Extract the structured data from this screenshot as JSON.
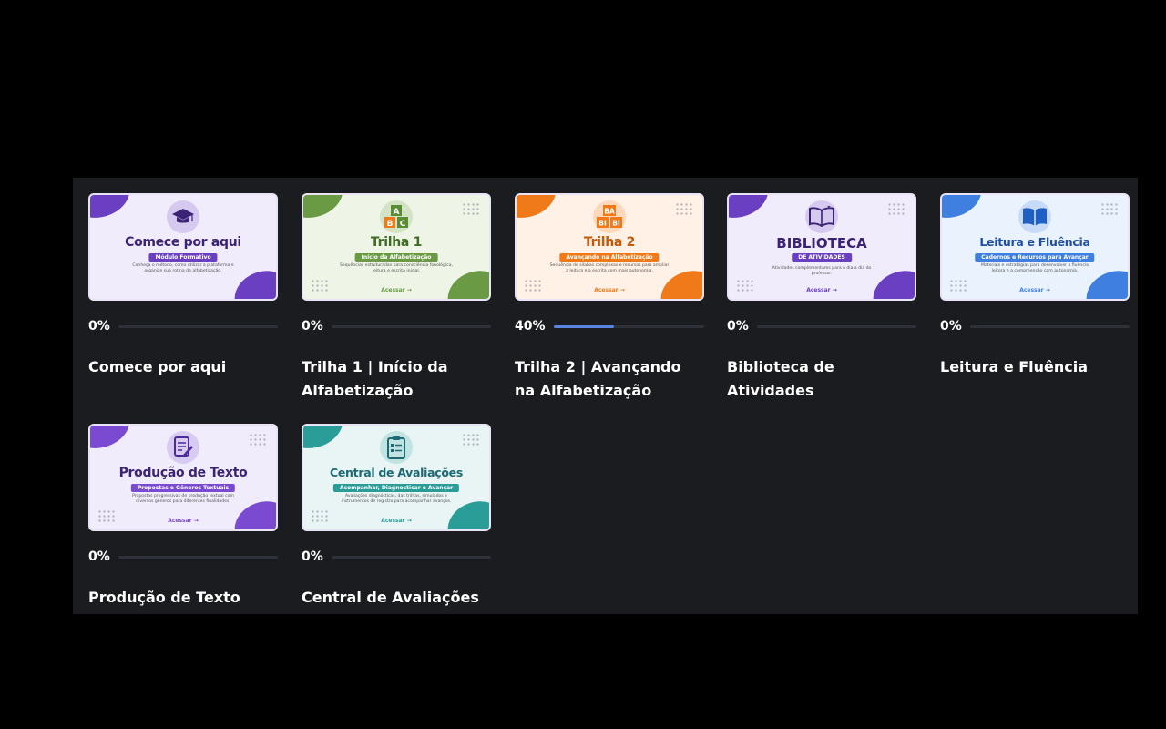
{
  "courses": [
    {
      "thumb": {
        "title": "Comece por aqui",
        "pill": "Módulo Formativo",
        "desc": "Conheça o método, como utilizar a plataforma e organize sua rotina de alfabetização.",
        "access": "",
        "icon": "graduation-cap-icon"
      },
      "colors": {
        "bg": "#f1ecfb",
        "accent": "#6a3fc1",
        "title": "#3a2374"
      },
      "progress_label": "0%",
      "progress": 0,
      "name": "Comece por aqui"
    },
    {
      "thumb": {
        "title": "Trilha 1",
        "pill": "Início da Alfabetização",
        "desc": "Sequências estruturadas para consciência fonológica, leitura e escrita inicial.",
        "access": "Acessar →",
        "icon": "abc-blocks-icon"
      },
      "colors": {
        "bg": "#eef5e6",
        "accent": "#6b9a45",
        "title": "#3f6b24"
      },
      "progress_label": "0%",
      "progress": 0,
      "name": "Trilha 1 | Início da Alfabetização"
    },
    {
      "thumb": {
        "title": "Trilha 2",
        "pill": "Avançando na Alfabetização",
        "desc": "Sequência de sílabas complexas e recursos para ampliar a leitura e a escrita com mais autonomia.",
        "access": "Acessar →",
        "icon": "syllable-blocks-icon"
      },
      "colors": {
        "bg": "#fff1e6",
        "accent": "#f07a1a",
        "title": "#c25a0c"
      },
      "progress_label": "40%",
      "progress": 0.4,
      "name": "Trilha 2 | Avançando na Alfabetização"
    },
    {
      "thumb": {
        "title": "BIBLIOTECA",
        "pill": "DE ATIVIDADES",
        "desc": "Atividades complementares para o dia a dia do professor.",
        "access": "Acessar →",
        "icon": "open-book-icon"
      },
      "colors": {
        "bg": "#f1ecfb",
        "accent": "#6a3fc1",
        "title": "#3a2374"
      },
      "progress_label": "0%",
      "progress": 0,
      "name": "Biblioteca de Atividades"
    },
    {
      "thumb": {
        "title": "Leitura e Fluência",
        "pill": "Cadernos e Recursos para Avançar",
        "desc": "Materiais e estratégias para desenvolver a fluência leitora e a compreensão com autonomia.",
        "access": "Acessar →",
        "icon": "book-icon"
      },
      "colors": {
        "bg": "#eaf2fd",
        "accent": "#3e7fe0",
        "title": "#1f4fa5"
      },
      "progress_label": "0%",
      "progress": 0,
      "name": "Leitura e Fluência"
    },
    {
      "thumb": {
        "title": "Produção de Texto",
        "pill": "Propostas e Gêneros Textuais",
        "desc": "Propostas progressivas de produção textual com diversos gêneros para diferentes finalidades.",
        "access": "Acessar →",
        "icon": "document-pen-icon"
      },
      "colors": {
        "bg": "#f1ecfb",
        "accent": "#7a4bd0",
        "title": "#3a2374"
      },
      "progress_label": "0%",
      "progress": 0,
      "name": "Produção de Texto"
    },
    {
      "thumb": {
        "title": "Central de Avaliações",
        "pill": "Acompanhar, Diagnosticar e Avançar",
        "desc": "Avaliações diagnósticas, das trilhas, simulados e instrumentos de registro para acompanhar avanços.",
        "access": "Acessar →",
        "icon": "clipboard-checklist-icon"
      },
      "colors": {
        "bg": "#e8f5f4",
        "accent": "#2a9d99",
        "title": "#1d6a74"
      },
      "progress_label": "0%",
      "progress": 0,
      "name": "Central de Avaliações"
    }
  ]
}
